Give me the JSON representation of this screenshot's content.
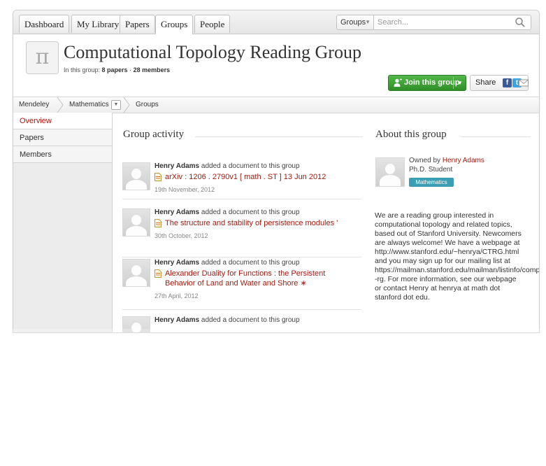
{
  "nav": {
    "tabs": [
      {
        "label": "Dashboard"
      },
      {
        "label": "My Library"
      },
      {
        "label": "Papers"
      },
      {
        "label": "Groups",
        "active": true
      },
      {
        "label": "People"
      }
    ],
    "search_scope": "Groups",
    "search_placeholder": "Search..."
  },
  "header": {
    "logo_glyph": "π",
    "title": "Computational Topology Reading Group",
    "meta_prefix": "In this group:",
    "papers_count": "8 papers",
    "meta_sep": "·",
    "members_count": "28 members",
    "join_label": "Join this group",
    "share_label": "Share",
    "accent_color": "#3aa532"
  },
  "breadcrumb": [
    "Mendeley",
    "Mathematics",
    "Groups"
  ],
  "sidenav": [
    {
      "label": "Overview",
      "active": true
    },
    {
      "label": "Papers"
    },
    {
      "label": "Members"
    }
  ],
  "activity": {
    "heading": "Group activity",
    "items": [
      {
        "user": "Henry Adams",
        "action": "added a document to this group",
        "doc": "arXiv : 1206 . 2790v1 [ math . ST ] 13 Jun 2012",
        "date": "19th November, 2012"
      },
      {
        "user": "Henry Adams",
        "action": "added a document to this group",
        "doc": "The structure and stability of persistence modules ’",
        "date": "30th October, 2012"
      },
      {
        "user": "Henry Adams",
        "action": "added a document to this group",
        "doc": "Alexander Duality for Functions : the Persistent Behavior of Land and Water and Shore ∗",
        "date": "27th April, 2012"
      },
      {
        "user": "Henry Adams",
        "action": "added a document to this group",
        "doc": "",
        "date": ""
      }
    ]
  },
  "about": {
    "heading": "About this group",
    "owned_by_label": "Owned by",
    "owner": "Henry Adams",
    "owner_role": "Ph.D. Student",
    "discipline": "Mathematics",
    "description": "We are a reading group interested in\ncomputational topology and related topics,\nbased out of Stanford University. Newcomers\nare always welcome! We have a webpage at\nhttp://www.stanford.edu/~henrya/CTRG.html\nand you may sign up for our mailing list at\nhttps://mailman.stanford.edu/mailman/listinfo/comptop\n-rg. For more information, see our webpage\nor contact Henry at henrya at math dot\nstanford dot edu.",
    "link_color": "#a21b10"
  }
}
